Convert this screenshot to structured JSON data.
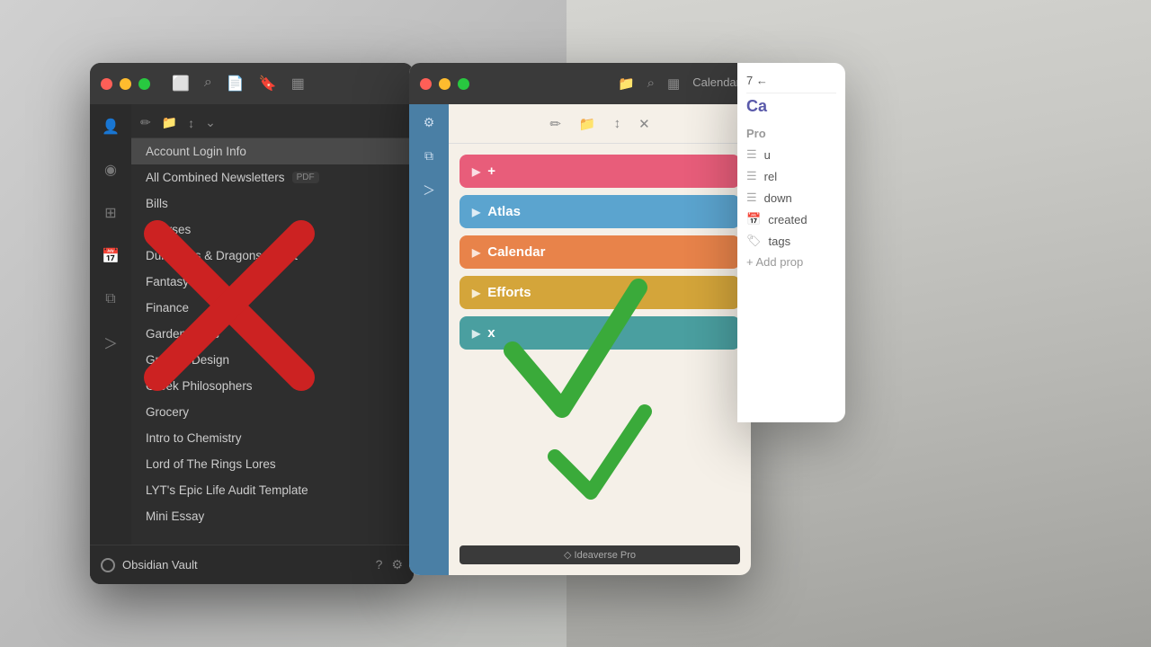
{
  "background": {
    "color": "#c8c8c8"
  },
  "window_left": {
    "titlebar": {
      "traffic_lights": [
        "close",
        "minimize",
        "maximize"
      ]
    },
    "toolbar": {
      "icons": [
        "folder",
        "search",
        "new-note",
        "bookmark",
        "layout"
      ]
    },
    "icon_rail": {
      "icons": [
        "person",
        "graph",
        "grid",
        "calendar",
        "copy",
        "terminal"
      ]
    },
    "file_toolbar": {
      "icons": [
        "edit",
        "new-folder",
        "sort",
        "chevron"
      ]
    },
    "files": [
      {
        "name": "Account Login Info",
        "selected": true,
        "badge": ""
      },
      {
        "name": "All Combined Newsletters",
        "selected": false,
        "badge": "PDF"
      },
      {
        "name": "Bills",
        "selected": false,
        "badge": ""
      },
      {
        "name": "Courses",
        "selected": false,
        "badge": ""
      },
      {
        "name": "Dungeons & Dragons Quest",
        "selected": false,
        "badge": ""
      },
      {
        "name": "Fantasy Films",
        "selected": false,
        "badge": ""
      },
      {
        "name": "Finance",
        "selected": false,
        "badge": ""
      },
      {
        "name": "Garden Ideas",
        "selected": false,
        "badge": ""
      },
      {
        "name": "Graphic Design",
        "selected": false,
        "badge": ""
      },
      {
        "name": "Greek Philosophers",
        "selected": false,
        "badge": ""
      },
      {
        "name": "Grocery",
        "selected": false,
        "badge": ""
      },
      {
        "name": "Intro to Chemistry",
        "selected": false,
        "badge": ""
      },
      {
        "name": "Lord of The Rings Lores",
        "selected": false,
        "badge": ""
      },
      {
        "name": "LYT's Epic Life Audit Template",
        "selected": false,
        "badge": ""
      },
      {
        "name": "Mini Essay",
        "selected": false,
        "badge": ""
      }
    ],
    "bottom": {
      "vault_name": "Obsidian Vault",
      "help_icon": "?",
      "settings_icon": "⚙"
    }
  },
  "window_right": {
    "titlebar": {
      "traffic_lights": [
        "close",
        "minimize",
        "maximize"
      ]
    },
    "icon_bar": {
      "icons": [
        "settings",
        "copy",
        "terminal"
      ]
    },
    "toolbar_icons": [
      "edit",
      "new-folder",
      "sort",
      "close"
    ],
    "folders": [
      {
        "name": "+",
        "color": "pink",
        "label": "+"
      },
      {
        "name": "Atlas",
        "color": "blue-light",
        "label": "Atlas"
      },
      {
        "name": "Calendar",
        "color": "orange",
        "label": "Calendar"
      },
      {
        "name": "Efforts",
        "color": "yellow",
        "label": "Efforts"
      },
      {
        "name": "x",
        "color": "teal",
        "label": "x"
      }
    ],
    "bottom_status": "Ideaverse Pro"
  },
  "calendar_panel": {
    "nav": "7 ←",
    "title": "Ca",
    "section": "Pro",
    "props": [
      {
        "icon": "list",
        "label": "u"
      },
      {
        "icon": "list",
        "label": "rel"
      },
      {
        "icon": "list",
        "label": "down"
      },
      {
        "icon": "calendar",
        "label": "created"
      },
      {
        "icon": "tag",
        "label": "tags"
      }
    ],
    "add_prop": "+ Add prop"
  },
  "icons": {
    "folder": "📁",
    "search": "🔍",
    "edit": "✏",
    "chevron": "⌃",
    "close": "✕",
    "sort": "↕",
    "settings": "⚙",
    "copy": "⧉",
    "terminal": "⌘",
    "calendar_tab": "Calendar"
  }
}
